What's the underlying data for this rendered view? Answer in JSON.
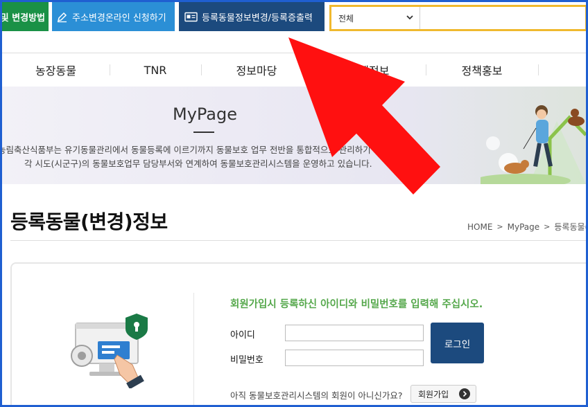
{
  "topbar": {
    "tab_method": "및 변경방법",
    "tab_address": "주소변경온라인 신청하기",
    "tab_register": "등록동물정보변경/등록증출력",
    "search_scope": "전체"
  },
  "nav": {
    "items": [
      {
        "label": "농장동물"
      },
      {
        "label": "TNR"
      },
      {
        "label": "정보마당"
      },
      {
        "label": "업체정보"
      },
      {
        "label": "정책홍보"
      }
    ]
  },
  "banner": {
    "title": "MyPage",
    "desc_line1": "농림축산식품부는 유기동물관리에서 동물등록에 이르기까지 동물보호 업무 전반을 통합적으로 관리하기 위해",
    "desc_line2": "각 시도(시군구)의 동물보호업무 담당부서와 연계하여 동물보호관리시스템을 운영하고 있습니다."
  },
  "page": {
    "title": "등록동물(변경)정보",
    "breadcrumb": [
      "HOME",
      "MyPage",
      "등록동물(변"
    ]
  },
  "login": {
    "message": "회원가입시 등록하신 아이디와 비밀번호를 입력해 주십시오.",
    "id_label": "아이디",
    "pw_label": "비밀번호",
    "login_button": "로그인",
    "signup_prompt": "아직 동물보호관리시스템의 회원이 아니신가요?",
    "signup_button": "회원가입"
  },
  "colors": {
    "green_tab": "#1a9146",
    "blue_tab": "#2b8fd6",
    "navy_tab": "#1c4a7e",
    "search_border": "#f0b92e",
    "message_green": "#55a84b",
    "arrow_red": "#ff1010",
    "frame_blue": "#1f5fd1"
  }
}
